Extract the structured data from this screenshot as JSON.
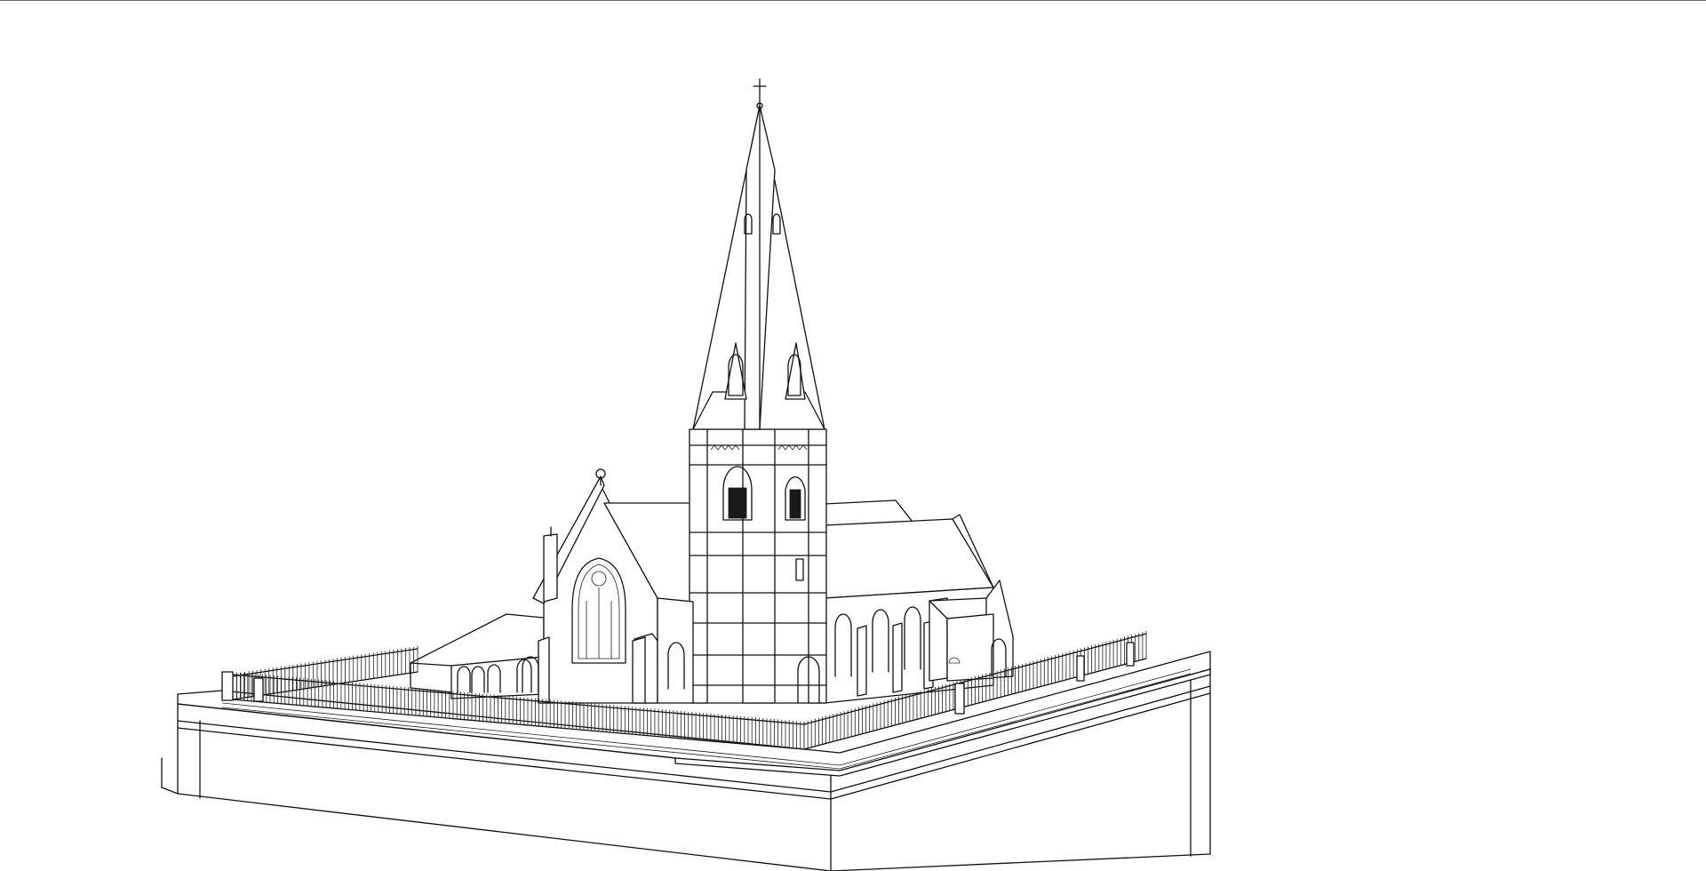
{
  "view": {
    "background": "#ffffff",
    "line_color": "#111111",
    "border_color": "#6d6d6d"
  },
  "model": {
    "icon": "church-line-drawing"
  }
}
